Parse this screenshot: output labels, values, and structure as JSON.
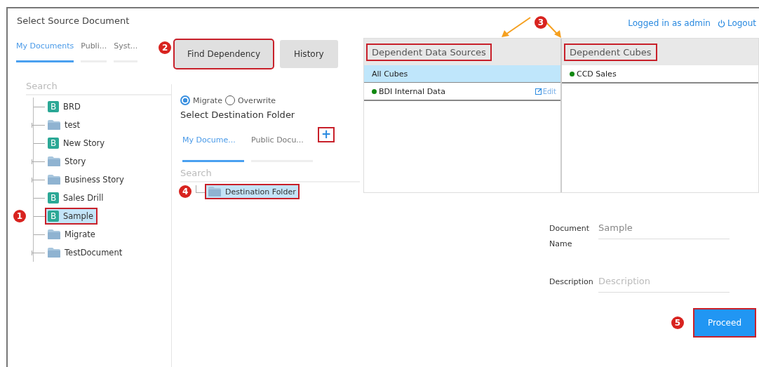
{
  "source": {
    "title": "Select Source Document",
    "tabs": [
      {
        "label": "My Documents",
        "selected": true
      },
      {
        "label": "Publi...",
        "selected": false
      },
      {
        "label": "Syst...",
        "selected": false
      }
    ],
    "search": {
      "placeholder": "Search"
    },
    "tree": [
      {
        "label": "BRD",
        "kind": "story",
        "icon_letter": "B",
        "expandable": false,
        "selected": false
      },
      {
        "label": "test",
        "kind": "folder",
        "expandable": true,
        "selected": false
      },
      {
        "label": "New Story",
        "kind": "story",
        "icon_letter": "B",
        "expandable": false,
        "selected": false
      },
      {
        "label": "Story",
        "kind": "folder",
        "expandable": true,
        "selected": false
      },
      {
        "label": "Business Story",
        "kind": "folder",
        "expandable": true,
        "selected": false
      },
      {
        "label": "Sales Drill",
        "kind": "story",
        "icon_letter": "B",
        "expandable": false,
        "selected": false
      },
      {
        "label": "Sample",
        "kind": "story",
        "icon_letter": "B",
        "expandable": false,
        "selected": true,
        "callout": "1"
      },
      {
        "label": "Migrate",
        "kind": "folder",
        "expandable": false,
        "selected": false
      },
      {
        "label": "TestDocument",
        "kind": "folder",
        "expandable": true,
        "selected": false
      }
    ]
  },
  "toolbar": [
    {
      "label": "Find Dependency",
      "callout": "2"
    },
    {
      "label": "History"
    }
  ],
  "destination": {
    "modes": [
      {
        "label": "Migrate",
        "selected": true
      },
      {
        "label": "Overwrite",
        "selected": false
      }
    ],
    "title": "Select Destination Folder",
    "tabs": [
      {
        "label": "My Docume...",
        "selected": true
      },
      {
        "label": "Public Docu...",
        "selected": false
      }
    ],
    "add_button": {
      "label": "+",
      "highlighted": true
    },
    "search": {
      "placeholder": "Search"
    },
    "tree": [
      {
        "label": "Destination Folder",
        "kind": "folder",
        "selected": true,
        "callout": "4"
      }
    ]
  },
  "session": {
    "user": "Logged in as admin",
    "logout": "Logout"
  },
  "dependencies": {
    "callout": "3",
    "panels": [
      {
        "title": "Dependent Data Sources",
        "highlighted": true,
        "items": [
          {
            "label": "All Cubes",
            "kind": "group",
            "selected": true
          },
          {
            "label": "BDI Internal Data",
            "kind": "source",
            "color": "#118811",
            "action": "Edit",
            "selected": false
          }
        ]
      },
      {
        "title": "Dependent Cubes",
        "highlighted": true,
        "items": [
          {
            "label": "CCD Sales",
            "kind": "source",
            "color": "#118811",
            "selected": false
          }
        ]
      }
    ]
  },
  "form": {
    "fields": [
      {
        "label": "Document Name",
        "value": "Sample"
      },
      {
        "label": "Description",
        "placeholder": "Description"
      }
    ],
    "submit": {
      "label": "Proceed",
      "callout": "5"
    }
  }
}
